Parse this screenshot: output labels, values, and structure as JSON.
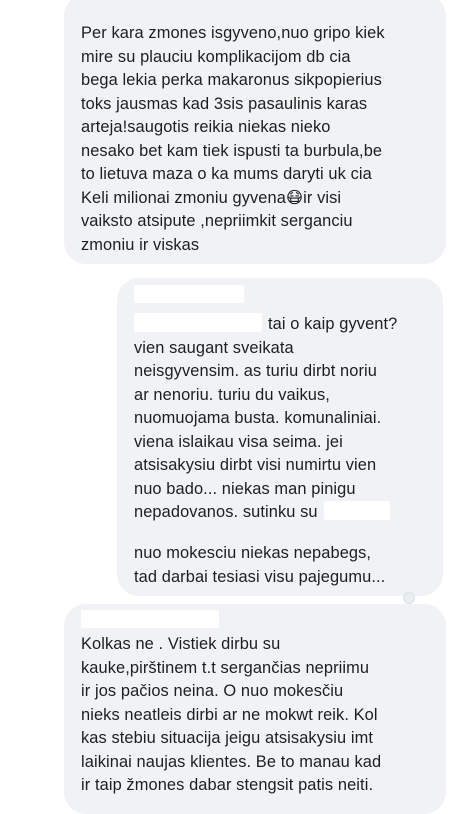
{
  "thread": {
    "messages": [
      {
        "text": "Per kara zmones isgyveno,nuo gripo kiek\nmire su plauciu komplikacijom db cia\nbega lekia perka makaronus sikpopierius\ntoks jausmas kad 3sis pasaulinis karas\narteja!saugotis reikia niekas nieko\nnesako bet kam tiek ispusti ta burbula,be\nto lietuva maza o ka mums daryti uk cia\nKeli milionai zmoniu gyvena",
        "emoji": "😷",
        "text_after": "ir visi\nvaiksto atsipute ,nepriimkit serganciu\nzmoniu ir viskas"
      },
      {
        "first_line": "tai o kaip gyvent?",
        "text": "vien saugant sveikata\nneisgyvensim. as turiu dirbt noriu\nar nenoriu. turiu du vaikus,\nnuomuojama busta. komunaliniai.\nviena islaikau visa seima. jei\natsisakysiu dirbt visi numirtu vien\nnuo bado... niekas man pinigu\nnepadovanos. sutinku su",
        "text2": "nuo mokesciu niekas nepabegs,\ntad darbai tesiasi visu pajegumu..."
      },
      {
        "text": "Kolkas ne . Vistiek dirbu su\nkauke,pirštinem t.t sergančias nepriimu\nir jos pačios neina. O nuo mokesčiu\nnieks neatleis dirbi ar ne mokwt reik. Kol\nkas stebiu situacija jeigu atsisakysiu imt\nlaikinai naujas klientes. Be to manau kad\nir taip žmones dabar stengsit patis neiti."
      }
    ]
  }
}
